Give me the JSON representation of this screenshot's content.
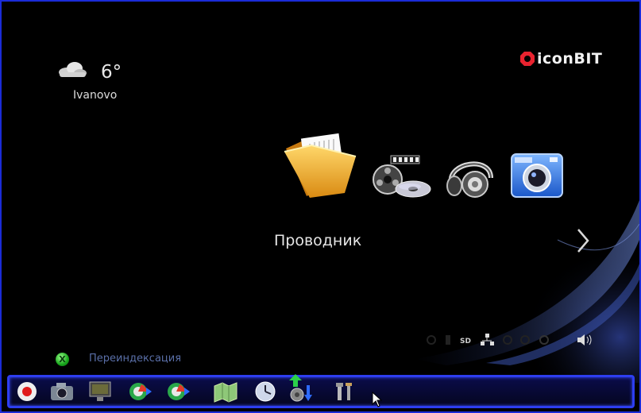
{
  "weather": {
    "temperature": "6°",
    "city": "Ivanovo",
    "icon": "cloud-icon"
  },
  "brand": {
    "logo_text": "iconBIT",
    "logo_color": "#e8232f"
  },
  "main_menu": {
    "selected_label": "Проводник",
    "items": [
      {
        "name": "file-explorer",
        "icon": "folder-icon"
      },
      {
        "name": "video",
        "icon": "film-reel-disc-icon"
      },
      {
        "name": "music",
        "icon": "headphones-icon"
      },
      {
        "name": "photo",
        "icon": "camera-icon"
      }
    ],
    "next_icon": "chevron-right-icon"
  },
  "status_icons": [
    "usb-icon",
    "card-icon",
    "sd-icon",
    "network-icon",
    "disc-icon",
    "hdd-icon",
    "power-icon",
    "volume-icon"
  ],
  "footer": {
    "reindex_label": "Переиндексация",
    "button_color": "#1ea820"
  },
  "taskbar": {
    "items": [
      "record-icon",
      "camera-icon",
      "monitor-icon",
      "media-player-icon",
      "media-player-icon",
      "map-icon",
      "clock-icon",
      "download-icon",
      "tools-icon"
    ]
  },
  "colors": {
    "frame": "#1b2cd8",
    "accent_blue": "#2d3ef0",
    "background": "#000000"
  }
}
